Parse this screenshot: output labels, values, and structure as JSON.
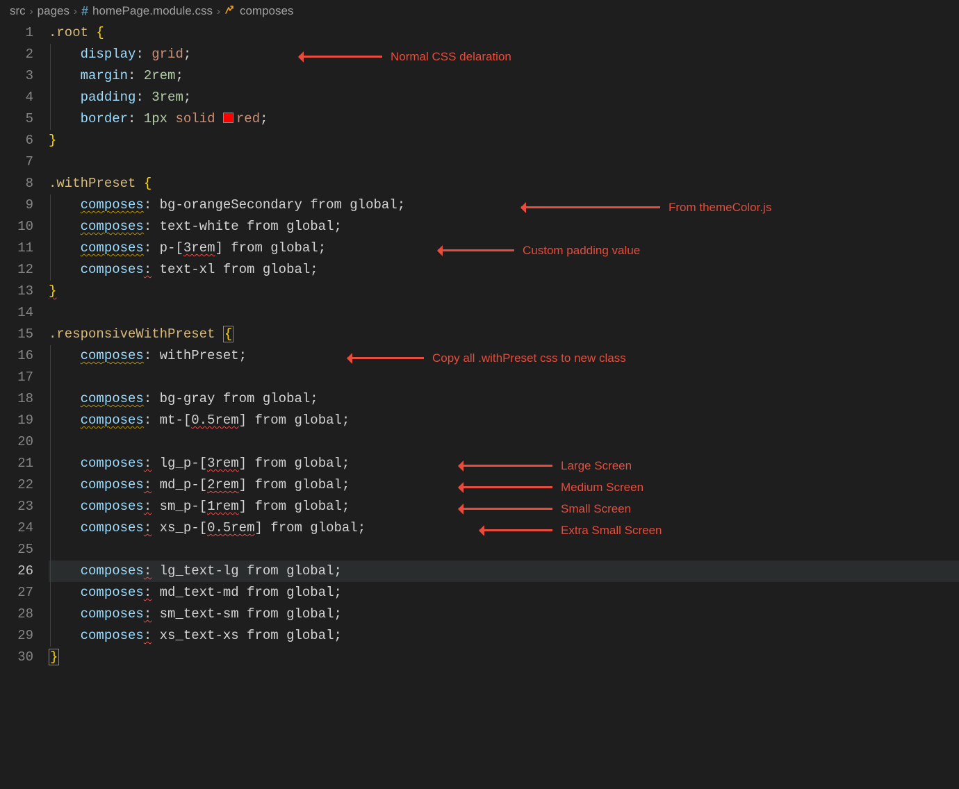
{
  "breadcrumb": {
    "parts": [
      "src",
      "pages",
      "homePage.module.css",
      "composes"
    ]
  },
  "annotations": {
    "a1": "Normal CSS delaration",
    "a2": "From themeColor.js",
    "a3": "Custom padding value",
    "a4": "Copy all .withPreset css to new class",
    "a5": "Large Screen",
    "a6": "Medium Screen",
    "a7": "Small Screen",
    "a8": "Extra Small Screen"
  },
  "code": {
    "lines": [
      {
        "n": 1,
        "indent": 0,
        "segs": [
          {
            "t": ".root ",
            "c": "t-sel"
          },
          {
            "t": "{",
            "c": "t-brace"
          }
        ]
      },
      {
        "n": 2,
        "indent": 1,
        "segs": [
          {
            "t": "display",
            "c": "t-prop"
          },
          {
            "t": ": ",
            "c": "t-punc"
          },
          {
            "t": "grid",
            "c": "t-val"
          },
          {
            "t": ";",
            "c": "t-punc"
          }
        ]
      },
      {
        "n": 3,
        "indent": 1,
        "segs": [
          {
            "t": "margin",
            "c": "t-prop"
          },
          {
            "t": ": ",
            "c": "t-punc"
          },
          {
            "t": "2",
            "c": "t-num"
          },
          {
            "t": "rem",
            "c": "t-num"
          },
          {
            "t": ";",
            "c": "t-punc"
          }
        ]
      },
      {
        "n": 4,
        "indent": 1,
        "segs": [
          {
            "t": "padding",
            "c": "t-prop"
          },
          {
            "t": ": ",
            "c": "t-punc"
          },
          {
            "t": "3",
            "c": "t-num"
          },
          {
            "t": "rem",
            "c": "t-num"
          },
          {
            "t": ";",
            "c": "t-punc"
          }
        ]
      },
      {
        "n": 5,
        "indent": 1,
        "segs": [
          {
            "t": "border",
            "c": "t-prop"
          },
          {
            "t": ": ",
            "c": "t-punc"
          },
          {
            "t": "1",
            "c": "t-num"
          },
          {
            "t": "px",
            "c": "t-num"
          },
          {
            "t": " ",
            "c": "t-punc"
          },
          {
            "t": "solid",
            "c": "t-val"
          },
          {
            "t": " ",
            "c": "t-punc"
          },
          {
            "swatch": true
          },
          {
            "t": "red",
            "c": "t-val"
          },
          {
            "t": ";",
            "c": "t-punc"
          }
        ]
      },
      {
        "n": 6,
        "indent": 0,
        "segs": [
          {
            "t": "}",
            "c": "t-brace"
          }
        ]
      },
      {
        "n": 7,
        "indent": 0,
        "segs": []
      },
      {
        "n": 8,
        "indent": 0,
        "segs": [
          {
            "t": ".withPreset ",
            "c": "t-sel"
          },
          {
            "t": "{",
            "c": "t-brace"
          }
        ]
      },
      {
        "n": 9,
        "indent": 1,
        "segs": [
          {
            "t": "composes",
            "c": "t-prop",
            "u": "sq-yellow"
          },
          {
            "t": ": ",
            "c": "t-punc"
          },
          {
            "t": "bg-orangeSecondary from global",
            "c": "t-white"
          },
          {
            "t": ";",
            "c": "t-punc"
          }
        ]
      },
      {
        "n": 10,
        "indent": 1,
        "segs": [
          {
            "t": "composes",
            "c": "t-prop",
            "u": "sq-yellow"
          },
          {
            "t": ": ",
            "c": "t-punc"
          },
          {
            "t": "text-white from global",
            "c": "t-white"
          },
          {
            "t": ";",
            "c": "t-punc"
          }
        ]
      },
      {
        "n": 11,
        "indent": 1,
        "segs": [
          {
            "t": "composes",
            "c": "t-prop",
            "u": "sq-yellow"
          },
          {
            "t": ": ",
            "c": "t-punc"
          },
          {
            "t": "p-[",
            "c": "t-white"
          },
          {
            "t": "3rem",
            "c": "t-white",
            "u": "sq-red"
          },
          {
            "t": "] from global",
            "c": "t-white"
          },
          {
            "t": ";",
            "c": "t-punc"
          }
        ]
      },
      {
        "n": 12,
        "indent": 1,
        "segs": [
          {
            "t": "composes",
            "c": "t-prop"
          },
          {
            "t": ":",
            "c": "t-punc",
            "u": "sq-red"
          },
          {
            "t": " text-xl from global",
            "c": "t-white"
          },
          {
            "t": ";",
            "c": "t-punc"
          }
        ]
      },
      {
        "n": 13,
        "indent": 0,
        "segs": [
          {
            "t": "}",
            "c": "t-brace",
            "u": "sq-red"
          }
        ]
      },
      {
        "n": 14,
        "indent": 0,
        "segs": []
      },
      {
        "n": 15,
        "indent": 0,
        "segs": [
          {
            "t": ".responsiveWithPreset ",
            "c": "t-sel"
          },
          {
            "t": "{",
            "c": "t-brace",
            "box": true
          }
        ]
      },
      {
        "n": 16,
        "indent": 1,
        "segs": [
          {
            "t": "composes",
            "c": "t-prop",
            "u": "sq-yellow"
          },
          {
            "t": ": ",
            "c": "t-punc"
          },
          {
            "t": "withPreset",
            "c": "t-white"
          },
          {
            "t": ";",
            "c": "t-punc"
          }
        ]
      },
      {
        "n": 17,
        "indent": 1,
        "segs": []
      },
      {
        "n": 18,
        "indent": 1,
        "segs": [
          {
            "t": "composes",
            "c": "t-prop",
            "u": "sq-yellow"
          },
          {
            "t": ": ",
            "c": "t-punc"
          },
          {
            "t": "bg-gray from global",
            "c": "t-white"
          },
          {
            "t": ";",
            "c": "t-punc"
          }
        ]
      },
      {
        "n": 19,
        "indent": 1,
        "segs": [
          {
            "t": "composes",
            "c": "t-prop",
            "u": "sq-yellow"
          },
          {
            "t": ": ",
            "c": "t-punc"
          },
          {
            "t": "mt-[",
            "c": "t-white"
          },
          {
            "t": "0.5rem",
            "c": "t-white",
            "u": "sq-red"
          },
          {
            "t": "] from global",
            "c": "t-white"
          },
          {
            "t": ";",
            "c": "t-punc"
          }
        ]
      },
      {
        "n": 20,
        "indent": 1,
        "segs": []
      },
      {
        "n": 21,
        "indent": 1,
        "segs": [
          {
            "t": "composes",
            "c": "t-prop"
          },
          {
            "t": ":",
            "c": "t-punc",
            "u": "sq-red"
          },
          {
            "t": " lg_p-[",
            "c": "t-white"
          },
          {
            "t": "3rem",
            "c": "t-white",
            "u": "sq-red"
          },
          {
            "t": "] from global",
            "c": "t-white"
          },
          {
            "t": ";",
            "c": "t-punc"
          }
        ]
      },
      {
        "n": 22,
        "indent": 1,
        "segs": [
          {
            "t": "composes",
            "c": "t-prop"
          },
          {
            "t": ":",
            "c": "t-punc",
            "u": "sq-red"
          },
          {
            "t": " md_p-[",
            "c": "t-white"
          },
          {
            "t": "2rem",
            "c": "t-white",
            "u": "sq-red"
          },
          {
            "t": "] from global",
            "c": "t-white"
          },
          {
            "t": ";",
            "c": "t-punc"
          }
        ]
      },
      {
        "n": 23,
        "indent": 1,
        "segs": [
          {
            "t": "composes",
            "c": "t-prop"
          },
          {
            "t": ":",
            "c": "t-punc",
            "u": "sq-red"
          },
          {
            "t": " sm_p-[",
            "c": "t-white"
          },
          {
            "t": "1rem",
            "c": "t-white",
            "u": "sq-red"
          },
          {
            "t": "] from global",
            "c": "t-white"
          },
          {
            "t": ";",
            "c": "t-punc"
          }
        ]
      },
      {
        "n": 24,
        "indent": 1,
        "segs": [
          {
            "t": "composes",
            "c": "t-prop"
          },
          {
            "t": ":",
            "c": "t-punc",
            "u": "sq-red"
          },
          {
            "t": " xs_p-[",
            "c": "t-white"
          },
          {
            "t": "0.5rem",
            "c": "t-white",
            "u": "sq-red"
          },
          {
            "t": "] from global",
            "c": "t-white"
          },
          {
            "t": ";",
            "c": "t-punc"
          }
        ]
      },
      {
        "n": 25,
        "indent": 1,
        "segs": []
      },
      {
        "n": 26,
        "indent": 1,
        "current": true,
        "segs": [
          {
            "t": "composes",
            "c": "t-prop"
          },
          {
            "t": ":",
            "c": "t-punc",
            "u": "sq-red"
          },
          {
            "t": " lg_text-lg from global",
            "c": "t-white"
          },
          {
            "t": ";",
            "c": "t-punc"
          }
        ]
      },
      {
        "n": 27,
        "indent": 1,
        "segs": [
          {
            "t": "composes",
            "c": "t-prop"
          },
          {
            "t": ":",
            "c": "t-punc",
            "u": "sq-red"
          },
          {
            "t": " md_text-md from global",
            "c": "t-white"
          },
          {
            "t": ";",
            "c": "t-punc"
          }
        ]
      },
      {
        "n": 28,
        "indent": 1,
        "segs": [
          {
            "t": "composes",
            "c": "t-prop"
          },
          {
            "t": ":",
            "c": "t-punc",
            "u": "sq-red"
          },
          {
            "t": " sm_text-sm from global",
            "c": "t-white"
          },
          {
            "t": ";",
            "c": "t-punc"
          }
        ]
      },
      {
        "n": 29,
        "indent": 1,
        "segs": [
          {
            "t": "composes",
            "c": "t-prop"
          },
          {
            "t": ":",
            "c": "t-punc",
            "u": "sq-red"
          },
          {
            "t": " xs_text-xs from global",
            "c": "t-white"
          },
          {
            "t": ";",
            "c": "t-punc"
          }
        ]
      },
      {
        "n": 30,
        "indent": 0,
        "segs": [
          {
            "t": "}",
            "c": "t-brace",
            "box": true
          }
        ]
      }
    ]
  }
}
